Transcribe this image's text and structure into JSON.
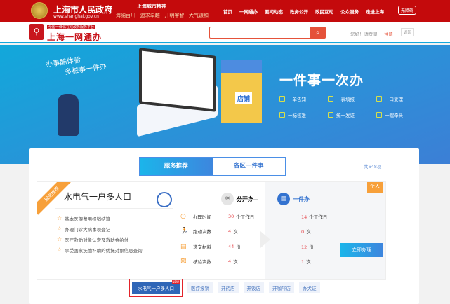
{
  "topbar": {
    "site_title": "上海市人民政府",
    "site_url": "www.shanghai.gov.cn",
    "slogan_title": "上海城市精神",
    "slogan": "海纳百川 · 追求卓越 · 开明睿智 · 大气谦和",
    "nav": [
      "首页",
      "一网通办",
      "要闻动态",
      "政务公开",
      "政民互动",
      "公众服务",
      "走进上海"
    ],
    "accessibility": "无障碍"
  },
  "header": {
    "platform_sub": "全国一体化在线政务服务平台",
    "platform_name": "上海一网通办",
    "search_placeholder": "",
    "greeting": "您好！请登录",
    "register": "注册",
    "back": "返回"
  },
  "banner": {
    "slogan_line1": "办事酷体验",
    "slogan_line2": "多桩事一件办",
    "shop_sign": "店铺",
    "title": "一件事一次办",
    "features": [
      "一单告知",
      "一表填报",
      "一口受理",
      "一标核准",
      "统一发证",
      "一帽牵头"
    ]
  },
  "card": {
    "tabs": [
      "服务推荐",
      "各区一件事"
    ],
    "count": "共648项",
    "ribbon": "服务推荐",
    "tag": "个人",
    "service_title": "水电气一户多人口",
    "items": [
      "基本医保费用报销结算",
      "办理门诊大病事项登记",
      "医疗救助对象认定及救助金给付",
      "享受国家抚恤补助的优抚对象信息查询"
    ],
    "mode_separate": "分开办",
    "mode_single": "一件办",
    "metrics": [
      {
        "label": "办理时间",
        "before": "30",
        "after": "14",
        "unit": "个工作日"
      },
      {
        "label": "跑动次数",
        "before": "4",
        "after": "0",
        "unit": "次"
      },
      {
        "label": "递交材料",
        "before": "44",
        "after": "12",
        "unit": "份"
      },
      {
        "label": "核验次数",
        "before": "4",
        "after": "1",
        "unit": "次"
      }
    ],
    "apply_button": "立即办理",
    "chips": [
      "水电气一户多人口",
      "医疗报销",
      "开药店",
      "开饭店",
      "开咖啡店",
      "办犬证"
    ],
    "new_badge": "NEW"
  }
}
